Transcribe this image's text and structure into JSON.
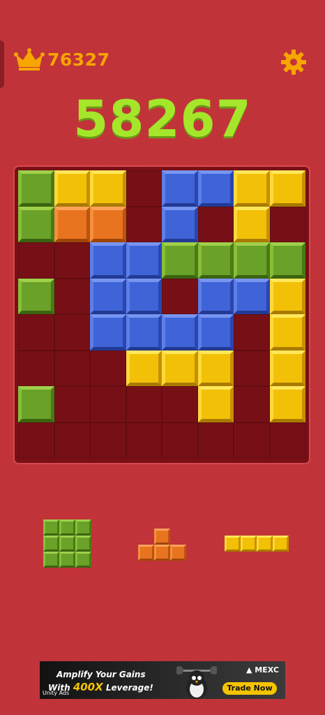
{
  "header": {
    "best_score": "76327",
    "best_icon": "crown-icon",
    "settings_icon": "gear-icon"
  },
  "score": "58267",
  "colors": {
    "background": "#c3343a",
    "board": "#7a0f15",
    "score": "#a5e62b",
    "best": "#f7a500",
    "green": "#6aa128",
    "yellow": "#f2c007",
    "blue": "#3f64d8",
    "orange": "#e8741f"
  },
  "board": {
    "size": 8,
    "legend": {
      "g": "green",
      "y": "yellow",
      "b": "blue",
      "o": "orange",
      ".": "empty"
    },
    "rows": [
      "gyy.bbyy",
      "goo.b.y.",
      "..bbgggg",
      "g.bb.bby",
      "..bbbb.y",
      "...yyy.y",
      "g....y.y",
      "........"
    ]
  },
  "pieces": [
    {
      "color": "g",
      "rows": [
        "ggg",
        "ggg",
        "ggg"
      ]
    },
    {
      "color": "o",
      "rows": [
        ".o.",
        "ooo"
      ]
    },
    {
      "color": "y",
      "rows": [
        "yyyy"
      ]
    }
  ],
  "ad": {
    "line1": "Amplify Your Gains",
    "line2_prefix": "With ",
    "line2_highlight": "400X",
    "line2_suffix": " Leverage!",
    "brand": "MEXC",
    "cta": "Trade Now",
    "network": "Unity Ads"
  }
}
